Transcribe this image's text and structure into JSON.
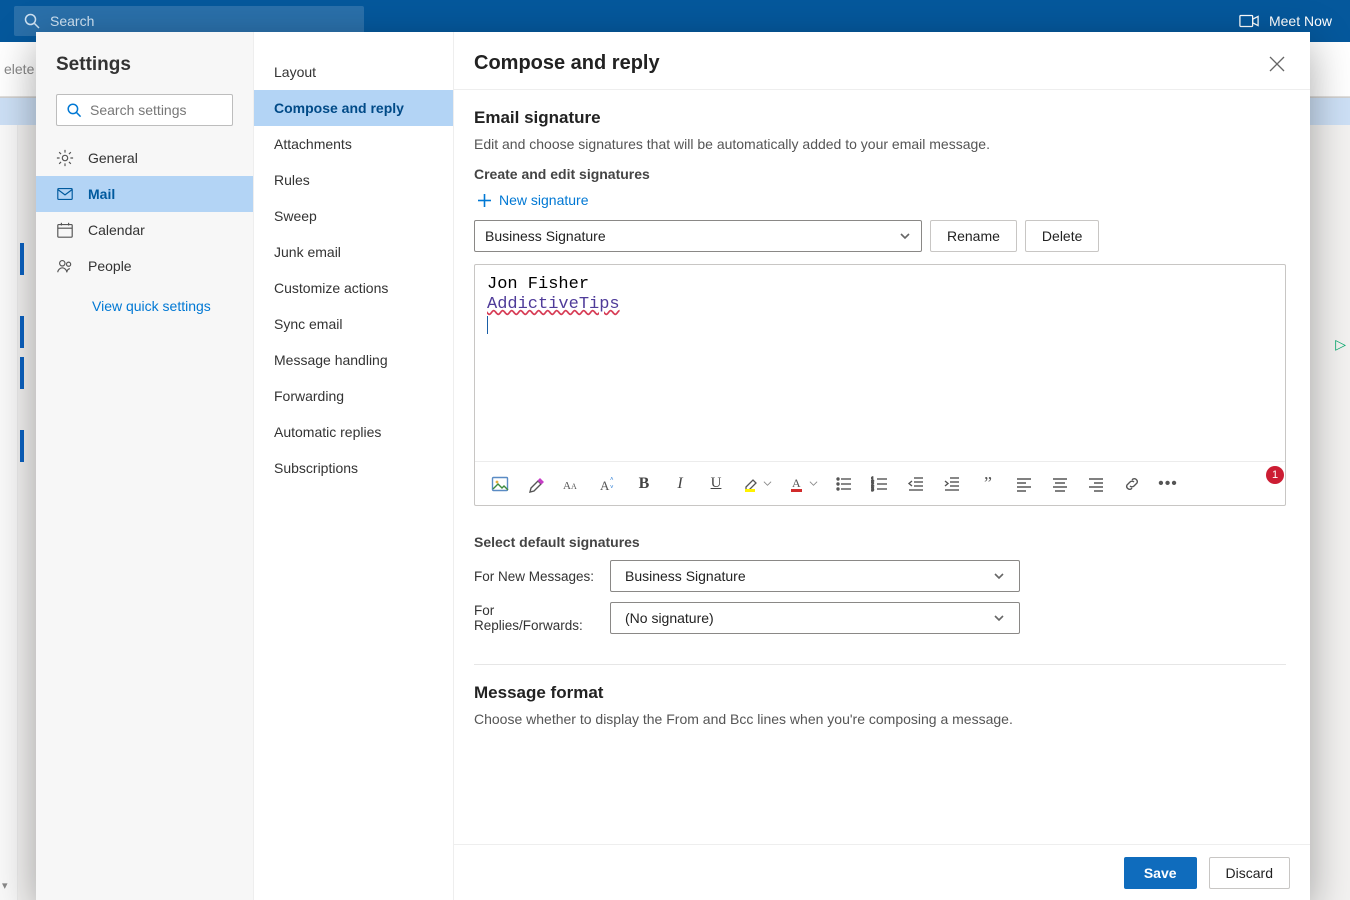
{
  "topbar": {
    "search_placeholder": "Search",
    "meet_now": "Meet Now"
  },
  "bg": {
    "delete_fragment": "elete",
    "badge": "1"
  },
  "settings": {
    "title": "Settings",
    "search_placeholder": "Search settings",
    "categories": [
      {
        "label": "General"
      },
      {
        "label": "Mail"
      },
      {
        "label": "Calendar"
      },
      {
        "label": "People"
      }
    ],
    "quick_link": "View quick settings"
  },
  "submenu": [
    "Layout",
    "Compose and reply",
    "Attachments",
    "Rules",
    "Sweep",
    "Junk email",
    "Customize actions",
    "Sync email",
    "Message handling",
    "Forwarding",
    "Automatic replies",
    "Subscriptions"
  ],
  "panel": {
    "title": "Compose and reply",
    "section_signature": {
      "heading": "Email signature",
      "desc": "Edit and choose signatures that will be automatically added to your email message.",
      "sub": "Create and edit signatures",
      "new_sig": "New signature",
      "selected_sig": "Business Signature",
      "rename": "Rename",
      "delete": "Delete",
      "editor_line1": "Jon Fisher",
      "editor_line2": "AddictiveTips",
      "select_default": "Select default signatures",
      "new_msg_label": "For New Messages:",
      "new_msg_value": "Business Signature",
      "replies_label": "For Replies/Forwards:",
      "replies_value": "(No signature)"
    },
    "section_format": {
      "heading": "Message format",
      "desc": "Choose whether to display the From and Bcc lines when you're composing a message."
    },
    "save": "Save",
    "discard": "Discard"
  }
}
